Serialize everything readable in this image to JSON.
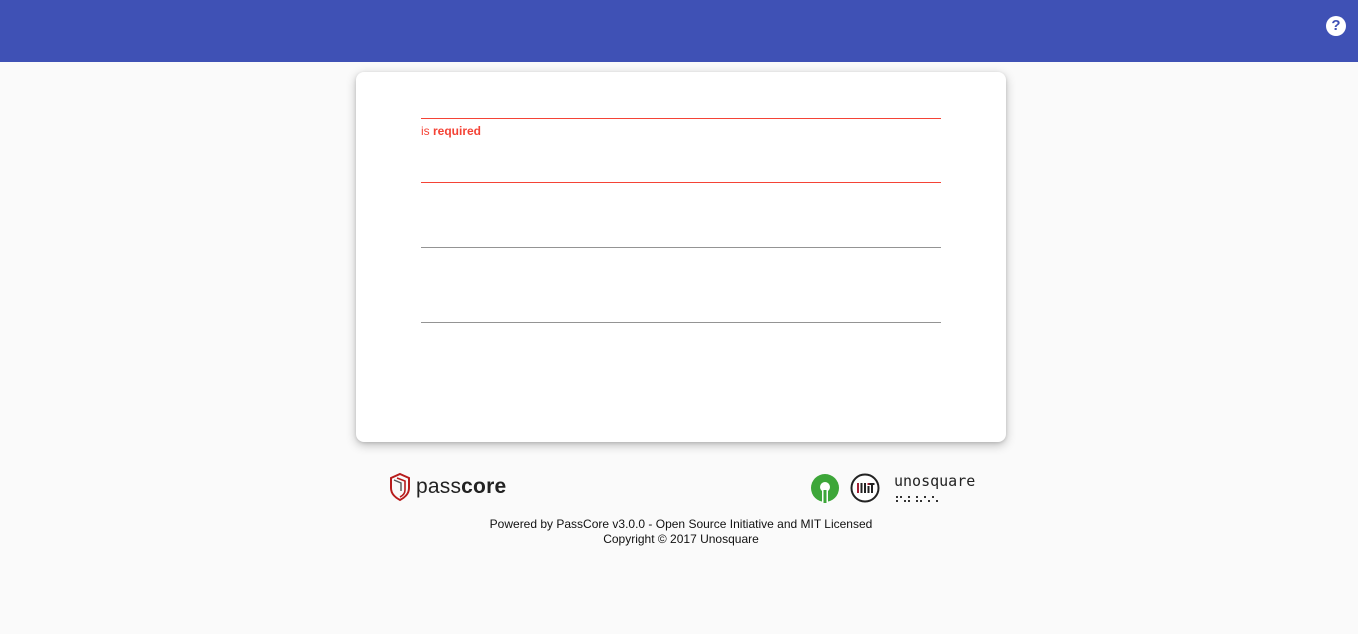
{
  "header": {
    "help_icon": "help-circle-icon",
    "help_label": "?"
  },
  "form": {
    "fields": [
      {
        "name": "username",
        "value": "",
        "placeholder": "",
        "error": true
      },
      {
        "name": "current-password",
        "value": "",
        "placeholder": "",
        "error": true
      },
      {
        "name": "new-password",
        "value": "",
        "placeholder": "",
        "error": false
      },
      {
        "name": "confirm-password",
        "value": "",
        "placeholder": "",
        "error": false
      }
    ],
    "helper_prefix": "is ",
    "helper_strong": "required"
  },
  "footer": {
    "passcore_brand_light": "pass",
    "passcore_brand_bold": "core",
    "unosquare_brand": "unosquare",
    "osi_icon": "open-source-initiative-icon",
    "mit_icon": "mit-license-icon",
    "line1": "Powered by PassCore v3.0.0 - Open Source Initiative and MIT Licensed",
    "line2": "Copyright © 2017 Unosquare"
  },
  "colors": {
    "appbar": "#3f51b5",
    "error": "#f44336",
    "background": "#fafafa"
  }
}
